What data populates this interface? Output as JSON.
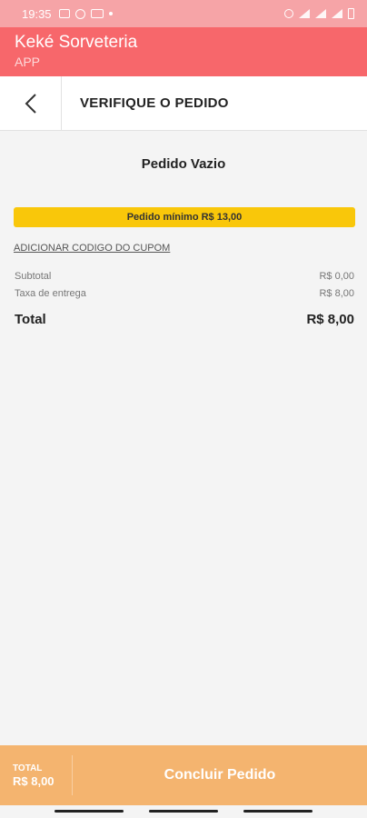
{
  "status_bar": {
    "time": "19:35",
    "icons_left": [
      "image-icon",
      "whatsapp-icon",
      "youtube-icon",
      "dot-icon"
    ],
    "icons_right": [
      "alarm-icon",
      "wifi-icon",
      "signal-icon",
      "signal-icon",
      "battery-icon"
    ]
  },
  "app_bar": {
    "title": "Keké Sorveteria",
    "subtitle": "APP"
  },
  "header": {
    "back_icon": "chevron-left-icon",
    "title": "VERIFIQUE O PEDIDO"
  },
  "cart": {
    "empty_title": "Pedido Vazio",
    "min_order_notice": "Pedido mínimo R$ 13,00",
    "coupon_link": "ADICIONAR CODIGO DO CUPOM",
    "subtotal_label": "Subtotal",
    "subtotal_value": "R$ 0,00",
    "delivery_fee_label": "Taxa de entrega",
    "delivery_fee_value": "R$ 8,00",
    "total_label": "Total",
    "total_value": "R$ 8,00"
  },
  "footer": {
    "total_label": "TOTAL",
    "total_value": "R$ 8,00",
    "conclude_button": "Concluir Pedido"
  },
  "colors": {
    "status_bar": "#f6a4a7",
    "app_bar": "#f7676b",
    "min_order_bg": "#f9c70a",
    "footer_bg": "#f4b46f"
  }
}
